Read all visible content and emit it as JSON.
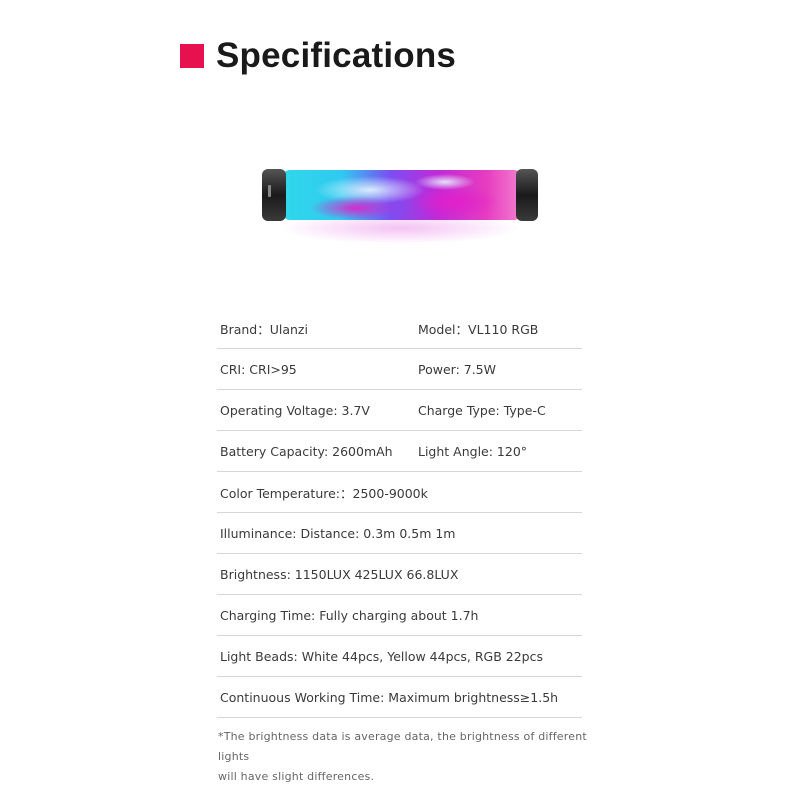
{
  "header": {
    "title": "Specifications",
    "accent_color": "#e8114f"
  },
  "product": {
    "icon": "rgb-light-tube-image",
    "colors": [
      "#29d3e6",
      "#6a4cf0",
      "#e21cc8",
      "#f055b5"
    ]
  },
  "specs": {
    "rows": [
      [
        "Brand：Ulanzi",
        "Model：VL110 RGB"
      ],
      [
        "CRI: CRI>95",
        "Power: 7.5W"
      ],
      [
        "Operating Voltage: 3.7V",
        "Charge Type: Type-C"
      ],
      [
        "Battery Capacity: 2600mAh",
        "Light Angle: 120°"
      ],
      [
        "Color Temperature:：2500-9000k"
      ],
      [
        "Illuminance: Distance: 0.3m 0.5m 1m"
      ],
      [
        "Brightness: 1150LUX 425LUX 66.8LUX"
      ],
      [
        "Charging Time: Fully charging about 1.7h"
      ],
      [
        "Light Beads: White 44pcs, Yellow 44pcs, RGB 22pcs"
      ],
      [
        "Continuous Working Time: Maximum brightness≥1.5h"
      ]
    ]
  },
  "footnote": {
    "line1": "*The brightness data is average data, the brightness of different lights",
    "line2": "will have slight differences."
  }
}
